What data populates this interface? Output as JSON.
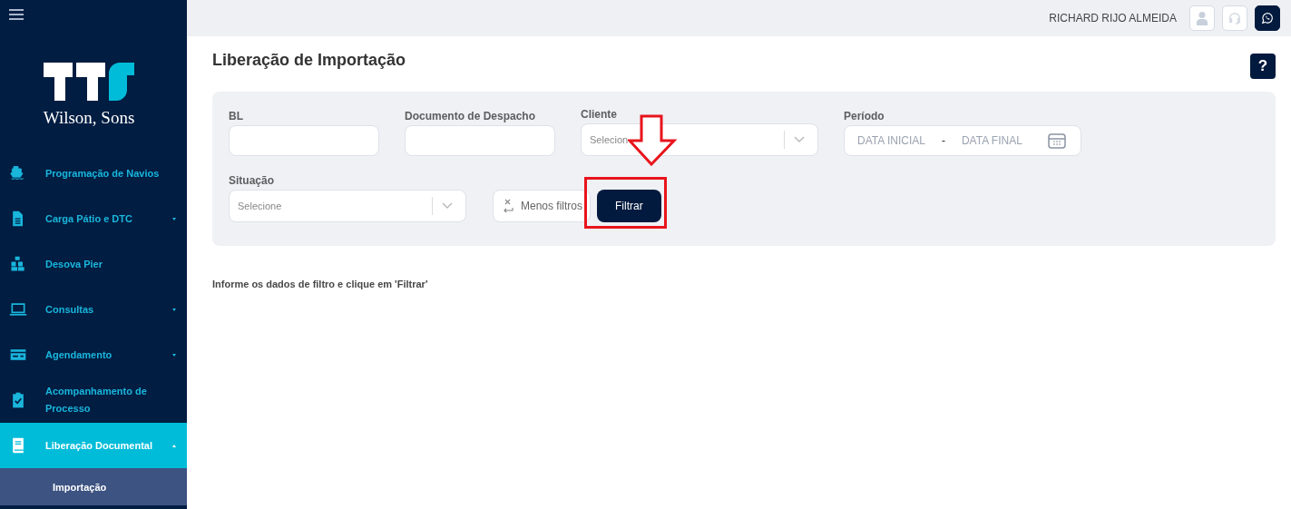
{
  "sidebar": {
    "logo_text": "Wilson, Sons",
    "items": [
      {
        "label": "Programação de Navios",
        "selected": false
      },
      {
        "label": "Carga Pátio e DTC",
        "selected": false,
        "expanded": false
      },
      {
        "label": "Desova Pier",
        "selected": false
      },
      {
        "label": "Consultas",
        "selected": false,
        "expanded": false
      },
      {
        "label": "Agendamento",
        "selected": false,
        "expanded": false
      },
      {
        "label": "Acompanhamento de Processo",
        "selected": false
      },
      {
        "label": "Liberação Documental",
        "selected": true,
        "expanded": true,
        "children": [
          {
            "label": "Importação",
            "selected": true
          }
        ]
      }
    ]
  },
  "header": {
    "user_name": "RICHARD RIJO ALMEIDA"
  },
  "page": {
    "title": "Liberação de Importação",
    "help": "?",
    "filters": [
      {
        "kind": "text",
        "label": "BL"
      },
      {
        "kind": "text",
        "label": "Documento de Despacho"
      },
      {
        "kind": "select",
        "label": "Cliente",
        "placeholder": "Selecion"
      },
      {
        "kind": "daterange",
        "label": "Período",
        "start_placeholder": "DATA INICIAL",
        "separator": "-",
        "end_placeholder": "DATA FINAL"
      },
      {
        "kind": "select",
        "label": "Situação",
        "placeholder": "Selecione"
      }
    ],
    "buttons": [
      {
        "kind": "secondary",
        "label": "Menos filtros"
      },
      {
        "kind": "primary",
        "label": "Filtrar"
      }
    ],
    "message": "Informe os dados de filtro e clique em 'Filtrar'"
  }
}
